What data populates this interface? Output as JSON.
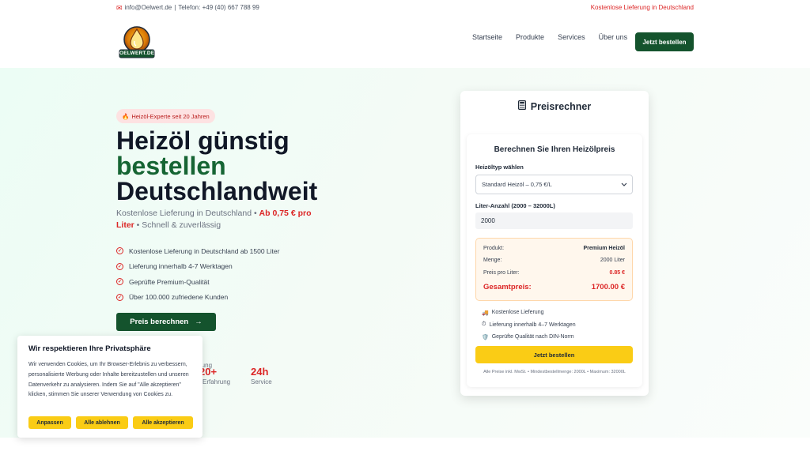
{
  "topbar": {
    "email": "info@Oelwert.de",
    "separator": "|",
    "phone": "Telefon: +49 (40) 667 788 99",
    "promo": "Kostenlose Lieferung in Deutschland"
  },
  "logo": {
    "text": "OELWERT.DE"
  },
  "nav": {
    "items": [
      {
        "label": "Startseite"
      },
      {
        "label": "Produkte"
      },
      {
        "label": "Services"
      },
      {
        "label": "Über uns"
      }
    ],
    "cta": "Jetzt bestellen"
  },
  "hero": {
    "badge_icon": "🔥",
    "badge": "Heizöl-Experte seit 20 Jahren",
    "title_line1": "Heizöl günstig",
    "title_line2": "bestellen",
    "title_line3": "Deutschlandweit",
    "sub_part1": "Kostenlose Lieferung in Deutschland",
    "sub_sep1": " • ",
    "sub_price": "Ab 0,75 € pro Liter",
    "sub_sep2": " • ",
    "sub_part2": "Schnell & zuverlässig",
    "features": [
      {
        "text": "Kostenlose Lieferung in Deutschland ab 1500 Liter"
      },
      {
        "text": "Lieferung innerhalb 4-7 Werktagen"
      },
      {
        "text": "Geprüfte Premium-Qualität"
      },
      {
        "text": "Über 100.000 zufriedene Kunden"
      }
    ],
    "cta": "Preis berechnen",
    "cta_arrow": "→",
    "stats": [
      {
        "num": "",
        "label": "rung"
      },
      {
        "num": "20+",
        "label": "Erfahrung"
      },
      {
        "num": "24h",
        "label": "Service"
      }
    ]
  },
  "calculator": {
    "title": "Preisrechner",
    "heading": "Berechnen Sie Ihren Heizölpreis",
    "type_label": "Heizöltyp wählen",
    "type_value": "Standard Heizöl – 0,75 €/L",
    "liter_label": "Liter-Anzahl (2000 – 32000L)",
    "liter_value": "2000",
    "summary": {
      "product_label": "Produkt:",
      "product_value": "Premium Heizöl",
      "qty_label": "Menge:",
      "qty_value": "2000 Liter",
      "ppl_label": "Preis pro Liter:",
      "ppl_value": "0.85 €",
      "total_label": "Gesamtpreis:",
      "total_value": "1700.00 €"
    },
    "benefits": [
      {
        "icon": "🚚",
        "text": "Kostenlose Lieferung"
      },
      {
        "icon": "⏱",
        "text": "Lieferung innerhalb 4–7 Werktagen"
      },
      {
        "icon": "🛡️",
        "text": "Geprüfte Qualität nach DIN-Norm"
      }
    ],
    "order_button": "Jetzt bestellen",
    "footnote": "Alle Preise inkl. MwSt. • Mindestbestellmenge: 2000L • Maximum: 32000L"
  },
  "cookie": {
    "title": "Wir respektieren Ihre Privatsphäre",
    "text": "Wir verwenden Cookies, um Ihr Browser-Erlebnis zu verbessern, personalisierte Werbung oder Inhalte bereitzustellen und unseren Datenverkehr zu analysieren. Indem Sie auf \"Alle akzeptieren\" klicken, stimmen Sie unserer Verwendung von Cookies zu.",
    "btn_customize": "Anpassen",
    "btn_reject": "Alle ablehnen",
    "btn_accept": "Alle akzeptieren"
  },
  "colors": {
    "brand_green": "#14532d",
    "accent_red": "#dc2626",
    "accent_yellow": "#facc15"
  }
}
